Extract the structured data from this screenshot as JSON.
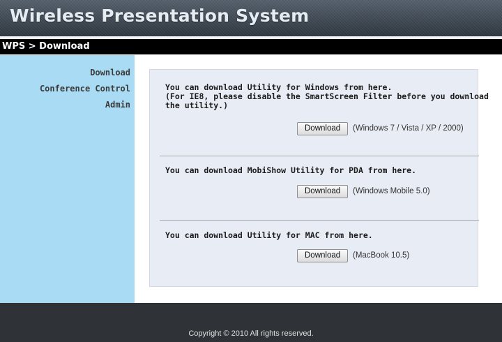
{
  "header": {
    "title": "Wireless Presentation System"
  },
  "breadcrumb": "WPS > Download",
  "sidebar": {
    "items": [
      {
        "label": "Download"
      },
      {
        "label": "Conference Control"
      },
      {
        "label": "Admin"
      }
    ]
  },
  "sections": [
    {
      "text": "You can download Utility for Windows from here.\n(For IE8, please disable the SmartScreen Filter before you download\nthe utility.)",
      "button_label": "Download",
      "note": "(Windows 7 / Vista / XP / 2000)"
    },
    {
      "text": "You can download MobiShow Utility for PDA from here.",
      "button_label": "Download",
      "note": "(Windows Mobile 5.0)"
    },
    {
      "text": "You can download Utility for MAC from here.",
      "button_label": "Download",
      "note": "(MacBook 10.5)"
    }
  ],
  "footer": {
    "copyright": "Copyright © 2010 All rights reserved."
  }
}
